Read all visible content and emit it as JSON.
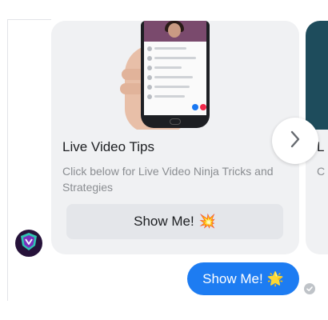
{
  "card": {
    "title": "Live Video Tips",
    "subtitle": "Click below for Live Video Ninja Tricks and Strategies",
    "button_label": "Show Me!",
    "button_emoji": "💥"
  },
  "next_card": {
    "title_peek": "L",
    "subtitle_peek": "C"
  },
  "user_message": {
    "text": "Show Me!",
    "emoji": "🌟"
  },
  "icons": {
    "next": "chevron-right-icon",
    "avatar": "bot-shield-logo",
    "status": "sent-check-icon"
  },
  "colors": {
    "user_bubble": "#1d7cf2",
    "card_bg": "#f0f1f3",
    "button_bg": "#e4e6ea",
    "subtitle": "#8a8d91"
  }
}
